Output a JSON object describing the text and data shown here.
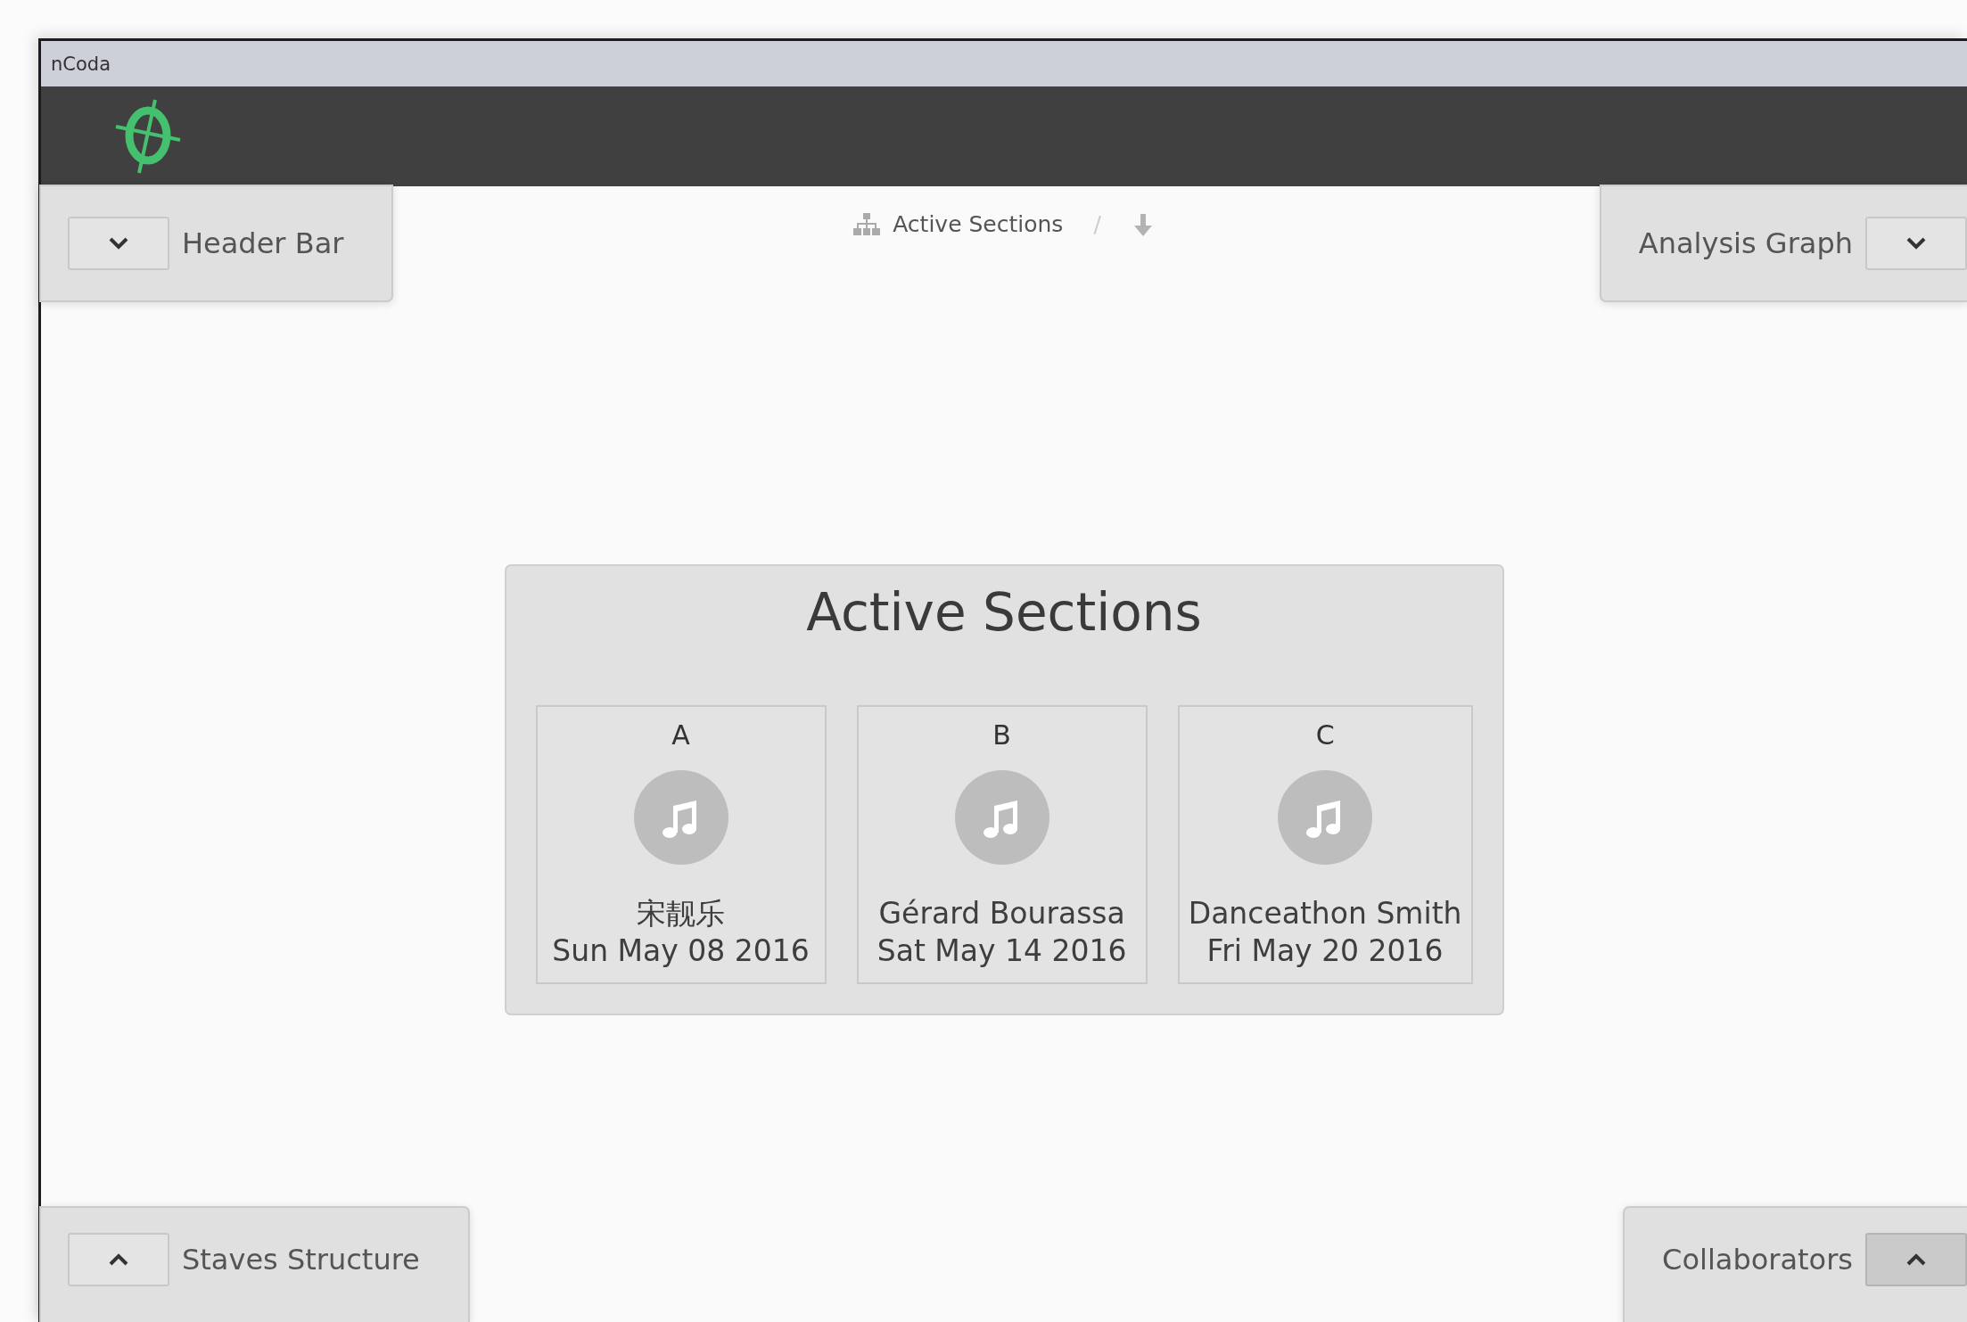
{
  "window": {
    "title": "nCoda"
  },
  "breadcrumb": {
    "label": "Active Sections",
    "separator": "/"
  },
  "top_panels": [
    {
      "label": "Header Bar",
      "kind": "down",
      "pressed": false
    },
    {
      "label": "Analysis Graph",
      "kind": "down",
      "pressed": false
    }
  ],
  "bottom_panels": [
    {
      "label": "Staves Structure",
      "kind": "up",
      "pressed": false
    },
    {
      "label": "Collaborators",
      "kind": "up",
      "pressed": true
    }
  ],
  "sections_card": {
    "title": "Active Sections",
    "sections": [
      {
        "letter": "A",
        "author": "宋靓乐",
        "date": "Sun May 08 2016"
      },
      {
        "letter": "B",
        "author": "Gérard Bourassa",
        "date": "Sat May 14 2016"
      },
      {
        "letter": "C",
        "author": "Danceathon Smith",
        "date": "Fri May 20 2016"
      }
    ]
  }
}
